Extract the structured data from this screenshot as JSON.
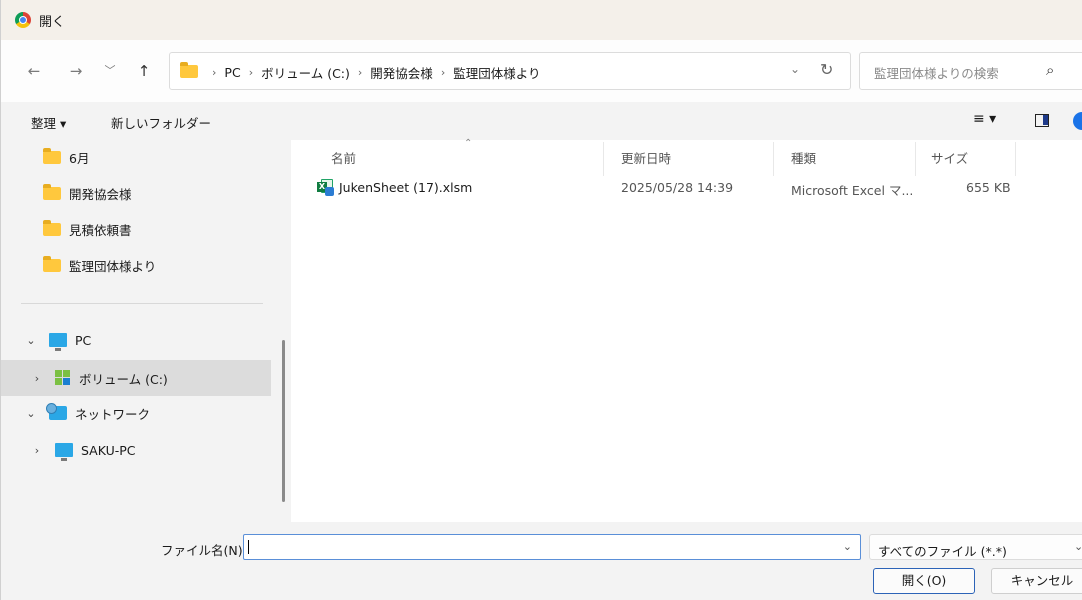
{
  "window": {
    "title": "開く"
  },
  "nav": {
    "back_icon": "←",
    "forward_icon": "→",
    "recent_icon": "﹀",
    "up_icon": "↑",
    "breadcrumbs": [
      "PC",
      "ボリューム (C:)",
      "開発協会様",
      "監理団体様より"
    ],
    "refresh_icon": "↻",
    "search_placeholder": "監理団体様よりの検索",
    "search_icon": "⌕"
  },
  "toolbar": {
    "organize": "整理 ▾",
    "new_folder": "新しいフォルダー",
    "view_icon": "≡ ▾"
  },
  "sidebar": {
    "folders": [
      "6月",
      "開発協会様",
      "見積依頼書",
      "監理団体様より"
    ],
    "pc": "PC",
    "volume": "ボリューム (C:)",
    "network": "ネットワーク",
    "saku_pc": "SAKU-PC",
    "expanded_icon": "⌄",
    "collapsed_icon": "›"
  },
  "columns": {
    "name": "名前",
    "modified": "更新日時",
    "type": "種類",
    "size": "サイズ"
  },
  "files": [
    {
      "name": "JukenSheet (17).xlsm",
      "modified": "2025/05/28 14:39",
      "type": "Microsoft Excel マ...",
      "size": "655 KB"
    }
  ],
  "bottom": {
    "filename_label": "ファイル名(N):",
    "filename_value": "",
    "filter": "すべてのファイル (*.*)",
    "open_button": "開く(O)",
    "cancel_button": "キャンセル"
  }
}
